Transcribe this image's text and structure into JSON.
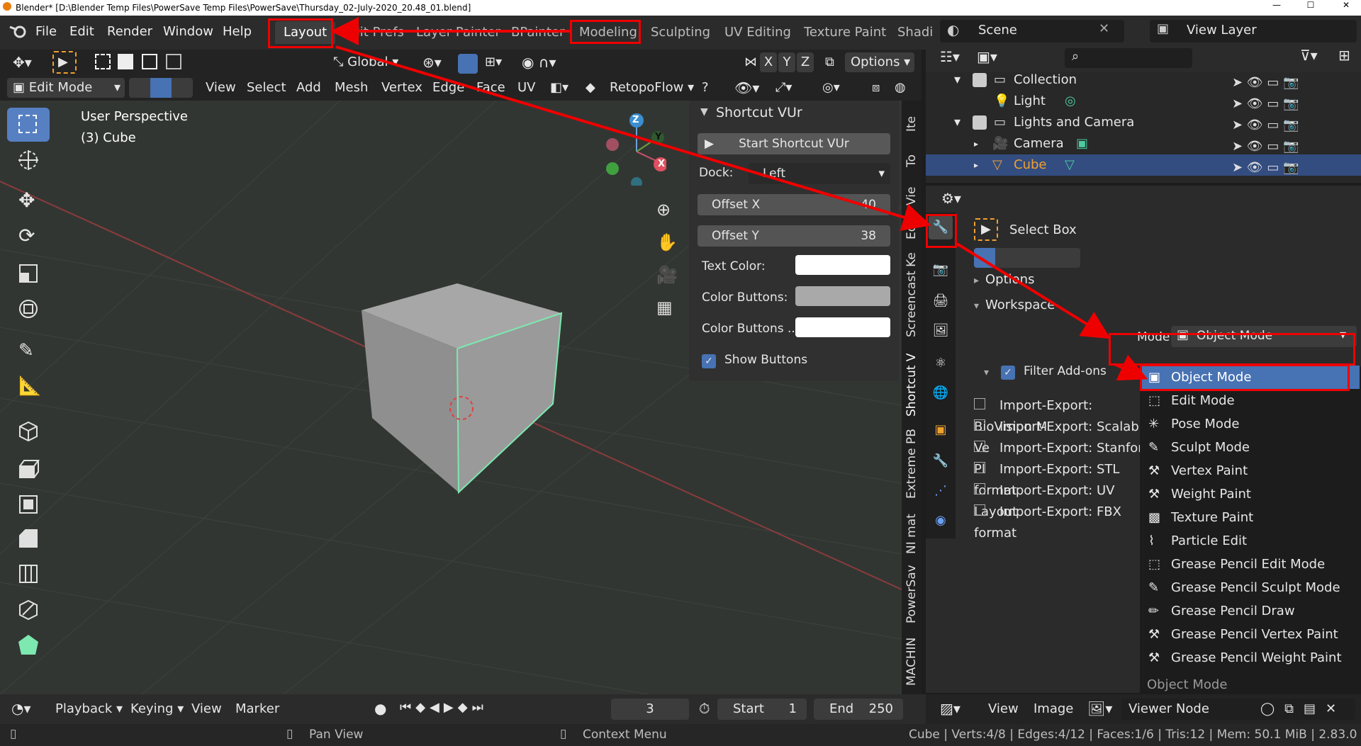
{
  "title_bar": {
    "text": "Blender* [D:\\Blender Temp Files\\PowerSave Temp Files\\PowerSave\\Thursday_02-July-2020_20.48_01.blend]"
  },
  "menu": [
    "File",
    "Edit",
    "Render",
    "Window",
    "Help"
  ],
  "workspaces": [
    "Layout",
    "Edit Prefs",
    "Layer Painter",
    "BPainter",
    "Modeling",
    "Sculpting",
    "UV Editing",
    "Texture Paint",
    "Shadi"
  ],
  "scene": {
    "name": "Scene",
    "view_layer": "View Layer"
  },
  "header": {
    "transform_orientation": "Global",
    "axes": [
      "X",
      "Y",
      "Z"
    ],
    "options": "Options",
    "mode": "Edit Mode",
    "menus": [
      "View",
      "Select",
      "Add",
      "Mesh",
      "Vertex",
      "Edge",
      "Face",
      "UV"
    ],
    "addon_menu": "RetopoFlow"
  },
  "viewport": {
    "perspective": "User Perspective",
    "object": "(3) Cube"
  },
  "gizmo": {
    "x": "X",
    "y": "Y",
    "z": "Z"
  },
  "npanel": {
    "title": "Shortcut VUr",
    "start_button": "Start Shortcut VUr",
    "dock_label": "Dock:",
    "dock_value": "Left",
    "offset_x_label": "Offset X",
    "offset_x_value": "40",
    "offset_y_label": "Offset Y",
    "offset_y_value": "38",
    "text_color_label": "Text Color:",
    "color_buttons_label": "Color Buttons:",
    "color_buttons2_label": "Color Buttons ...",
    "show_buttons_label": "Show Buttons"
  },
  "side_tabs": [
    "Ite",
    "To",
    "Vie",
    "Edi",
    "Screencast Ke",
    "Shortcut V",
    "Extreme PB",
    "NI mat",
    "PowerSav",
    "MACHIN"
  ],
  "outliner": {
    "rows": [
      {
        "label": "Collection"
      },
      {
        "label": "Light"
      },
      {
        "label": "Lights and Camera"
      },
      {
        "label": "Camera"
      },
      {
        "label": "Cube"
      }
    ]
  },
  "properties": {
    "tool": "Select Box",
    "options": "Options",
    "workspace": "Workspace",
    "mode_label": "Mode",
    "mode_value": "Object Mode",
    "filter_addons": "Filter Add-ons",
    "addons": [
      "Import-Export: BioVision M",
      "Import-Export: Scalable Ve",
      "Import-Export: Stanford Pl",
      "Import-Export: STL format",
      "Import-Export: UV Layout",
      "Import-Export: FBX format"
    ]
  },
  "mode_dropdown": {
    "items": [
      "Object Mode",
      "Edit Mode",
      "Pose Mode",
      "Sculpt Mode",
      "Vertex Paint",
      "Weight Paint",
      "Texture Paint",
      "Particle Edit",
      "Grease Pencil Edit Mode",
      "Grease Pencil Sculpt Mode",
      "Grease Pencil Draw",
      "Grease Pencil Vertex Paint",
      "Grease Pencil Weight Paint"
    ],
    "footer": "Object Mode",
    "selected": "Object Mode"
  },
  "timeline": {
    "playback": "Playback",
    "keying": "Keying",
    "view": "View",
    "marker": "Marker",
    "frame": "3",
    "start_label": "Start",
    "start": "1",
    "end_label": "End",
    "end": "250"
  },
  "image_editor": {
    "view": "View",
    "image": "Image",
    "viewer": "Viewer Node"
  },
  "status": {
    "pan": "Pan View",
    "context": "Context Menu",
    "stats": "Cube | Verts:4/8 | Edges:4/12 | Faces:1/6 | Tris:12 | Mem: 50.1 MiB | 2.83.0"
  },
  "colors": {
    "accent": "#4772b3",
    "annotation": "#e00000",
    "selected_row": "#334d80",
    "orange": "#f0a030"
  }
}
